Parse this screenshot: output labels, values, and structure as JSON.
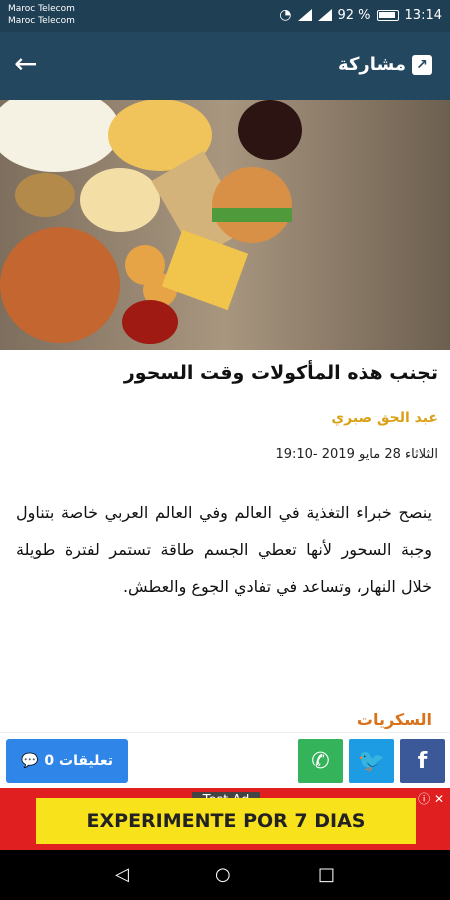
{
  "statusbar": {
    "carrier1": "Maroc Telecom",
    "carrier2": "Maroc Telecom",
    "battery": "92 %",
    "time": "13:14"
  },
  "appbar": {
    "back_icon": "arrow-left-icon",
    "share_label": "مشاركة"
  },
  "article": {
    "title": "تجنب هذه المأكولات وقت السحور",
    "author": "عبد الحق صبري",
    "date": "الثلاثاء 28 مايو 2019 -19:10",
    "body": "ينصح خبراء التغذية في العالم وفي العالم العربي خاصة بتناول وجبة السحور لأنها تعطي الجسم طاقة تستمر لفترة طويلة خلال النهار، وتساعد في تفادي الجوع والعطش.",
    "section": "السكريات"
  },
  "bottom": {
    "comments_label": "تعليقات 0",
    "share_buttons": [
      "whatsapp",
      "twitter",
      "facebook"
    ]
  },
  "ad": {
    "label": "Test Ad",
    "cta": "EXPERIMENTE POR 7 DIAS"
  },
  "navbar": {
    "back": "◁",
    "home": "○",
    "recent": "□"
  },
  "colors": {
    "appbar": "#23475e",
    "accent": "#d9a116",
    "comment_button": "#2f86e8",
    "ad_red": "#e02020"
  }
}
